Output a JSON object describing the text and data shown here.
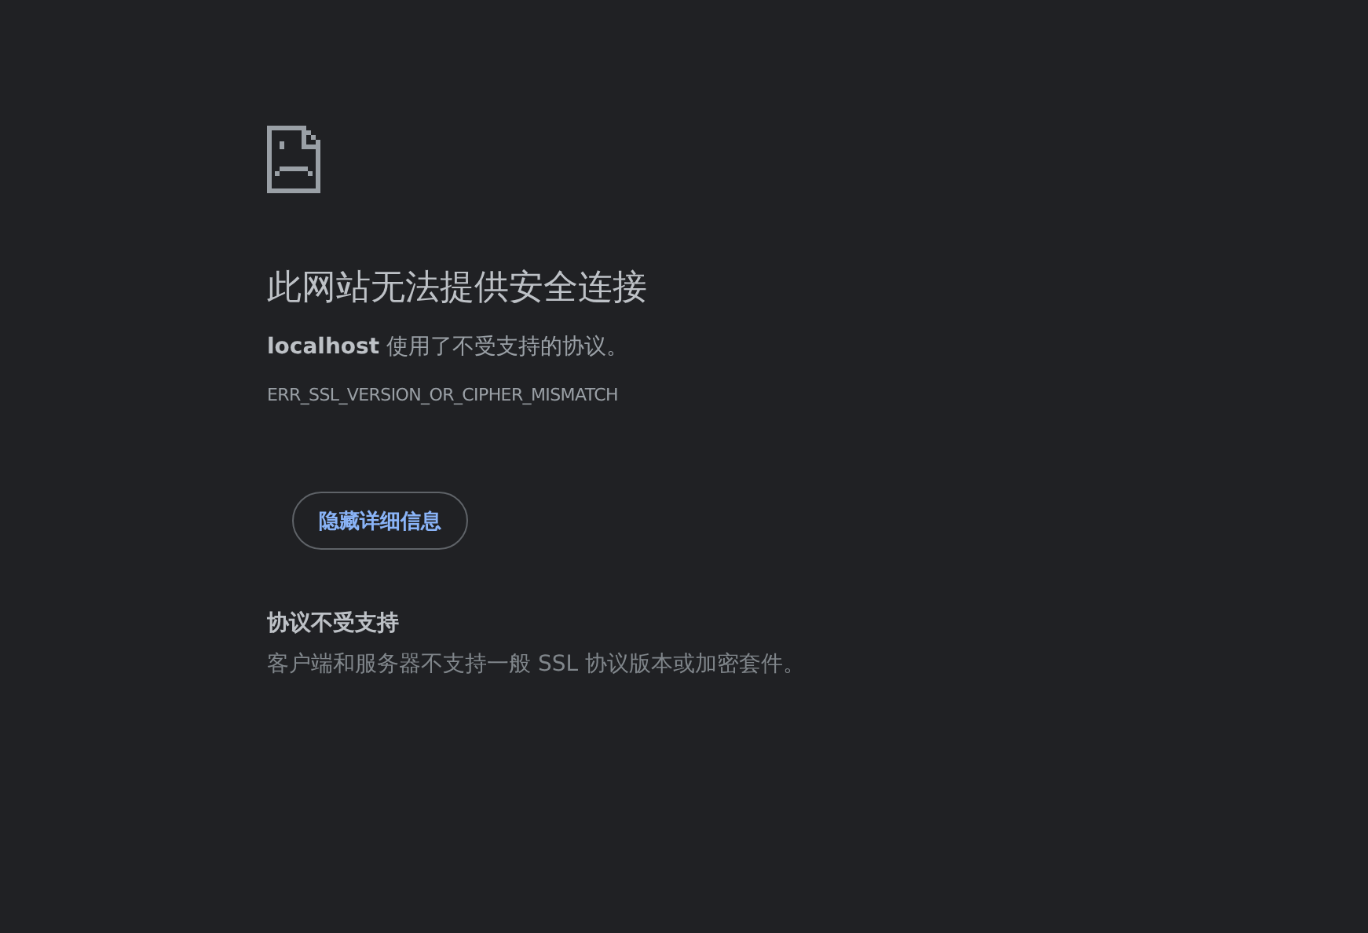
{
  "title": "此网站无法提供安全连接",
  "message": "**localhost** 使用了不受支持的协议。",
  "error_code": "ERR_SSL_VERSION_OR_CIPHER_MISMATCH",
  "details_button": "隐藏详细信息",
  "details": {
    "heading": "协议不受支持",
    "text": "客户端和服务器不支持一般 SSL 协议版本或加密套件。"
  }
}
